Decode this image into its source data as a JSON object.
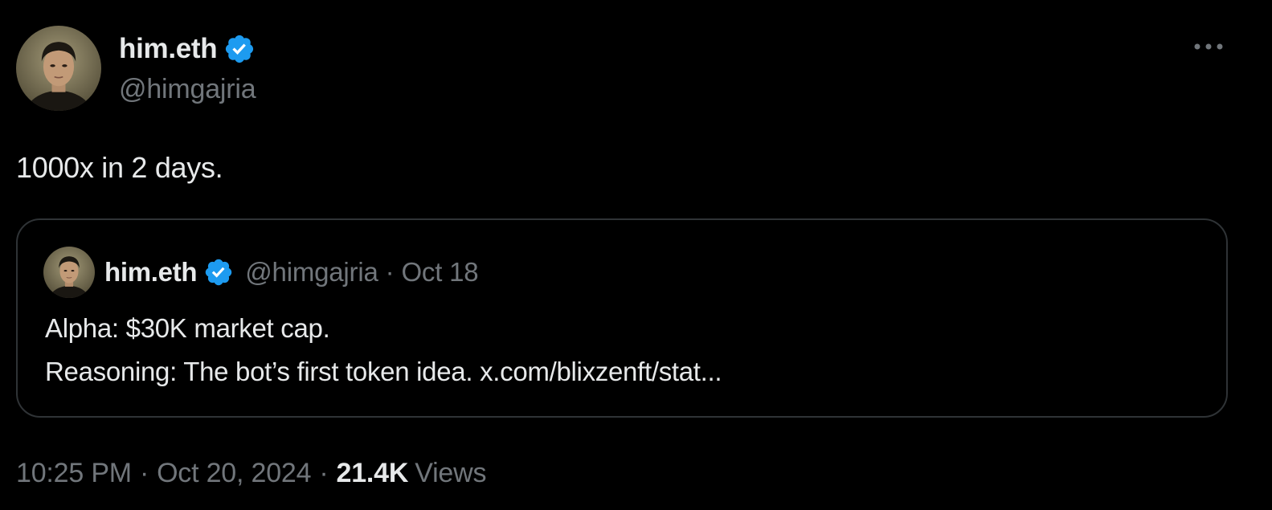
{
  "author": {
    "display_name": "him.eth",
    "handle": "@himgajria",
    "verified": true
  },
  "tweet": {
    "text": "1000x in 2 days.",
    "time": "10:25 PM",
    "date": "Oct 20, 2024",
    "views_count": "21.4K",
    "views_label": "Views",
    "separator": "·"
  },
  "quoted_tweet": {
    "display_name": "him.eth",
    "handle": "@himgajria",
    "separator": "·",
    "date": "Oct 18",
    "line1": "Alpha: $30K market cap.",
    "line2": "Reasoning: The bot’s first token idea. x.com/blixzenft/stat..."
  },
  "icons": {
    "verified": "verified-badge-icon",
    "more": "more-options-icon"
  },
  "colors": {
    "background": "#000000",
    "primary_text": "#e7e9ea",
    "secondary_text": "#71767b",
    "verified_blue": "#1d9bf0",
    "border": "#2f3336"
  }
}
